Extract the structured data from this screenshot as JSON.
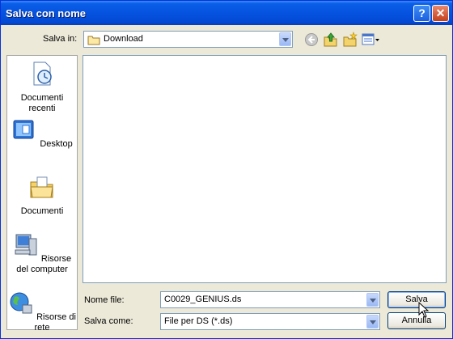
{
  "window": {
    "title": "Salva con nome"
  },
  "toolbar": {
    "save_in_label": "Salva in:",
    "location": "Download",
    "icons": [
      "back-icon",
      "up-folder-icon",
      "new-folder-icon",
      "views-menu-icon"
    ]
  },
  "places": [
    {
      "label": "Documenti recenti",
      "icon": "recent-documents-icon"
    },
    {
      "label": "Desktop",
      "icon": "desktop-icon"
    },
    {
      "label": "Documenti",
      "icon": "documents-folder-icon"
    },
    {
      "label": "Risorse del computer",
      "icon": "my-computer-icon"
    },
    {
      "label": "Risorse di rete",
      "icon": "network-icon"
    }
  ],
  "form": {
    "filename_label": "Nome file:",
    "filename_value": "C0029_GENIUS.ds",
    "filetype_label": "Salva come:",
    "filetype_value": "File per DS (*.ds)"
  },
  "buttons": {
    "save": "Salva",
    "cancel": "Annulla"
  },
  "colors": {
    "titlebar": "#0553e0",
    "dialog_bg": "#ece9d8",
    "close_button": "#c4401c"
  }
}
